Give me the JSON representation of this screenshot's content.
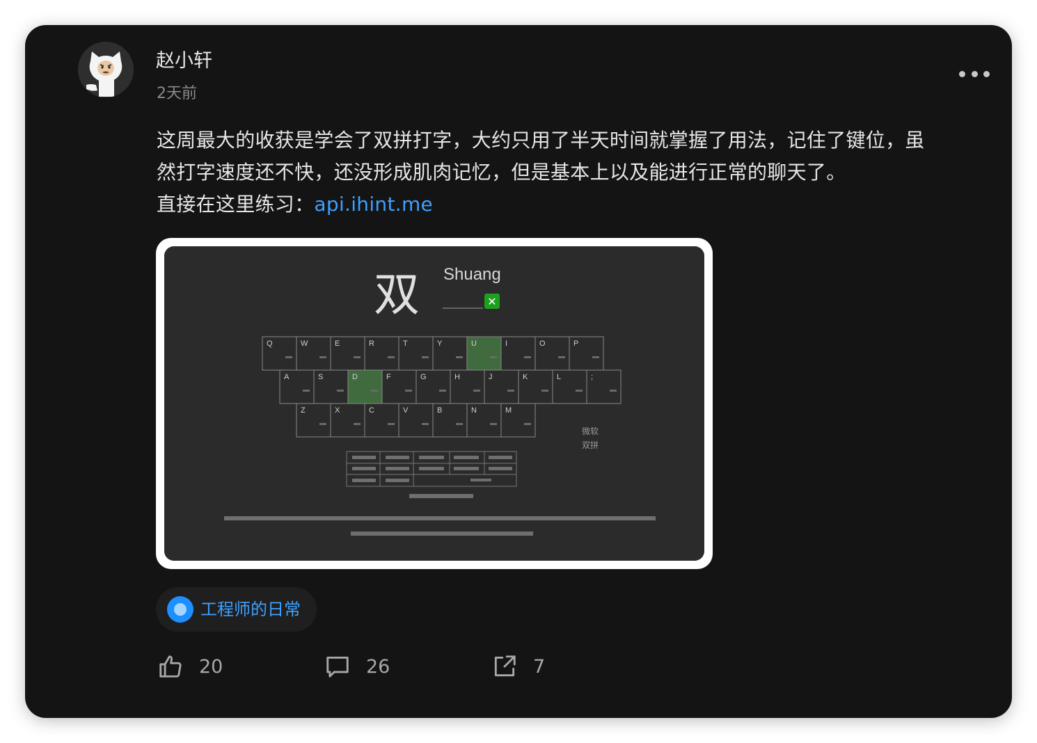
{
  "post": {
    "author": "赵小轩",
    "time": "2天前",
    "text_line1": "这周最大的收获是学会了双拼打字，大约只用了半天时间就掌握了用法，记住了键位，虽",
    "text_line2": "然打字速度还不快，还没形成肌肉记忆，但是基本上以及能进行正常的聊天了。",
    "text_line3_prefix": "直接在这里练习：",
    "link": "api.ihint.me"
  },
  "image": {
    "big_char": "双",
    "pinyin": "Shuang",
    "correct_mark": "✕",
    "keyboard": {
      "row1": [
        "Q",
        "W",
        "E",
        "R",
        "T",
        "Y",
        "U",
        "I",
        "O",
        "P"
      ],
      "row2": [
        "A",
        "S",
        "D",
        "F",
        "G",
        "H",
        "J",
        "K",
        "L",
        ";"
      ],
      "row3": [
        "Z",
        "X",
        "C",
        "V",
        "B",
        "N",
        "M"
      ]
    },
    "scheme_name_1": "微软",
    "scheme_name_2": "双拼"
  },
  "topic": {
    "label": "工程师的日常"
  },
  "actions": {
    "likes": "20",
    "comments": "26",
    "shares": "7"
  },
  "colors": {
    "background": "#141414",
    "link": "#3ea0ff",
    "text": "#e6e6e6"
  }
}
